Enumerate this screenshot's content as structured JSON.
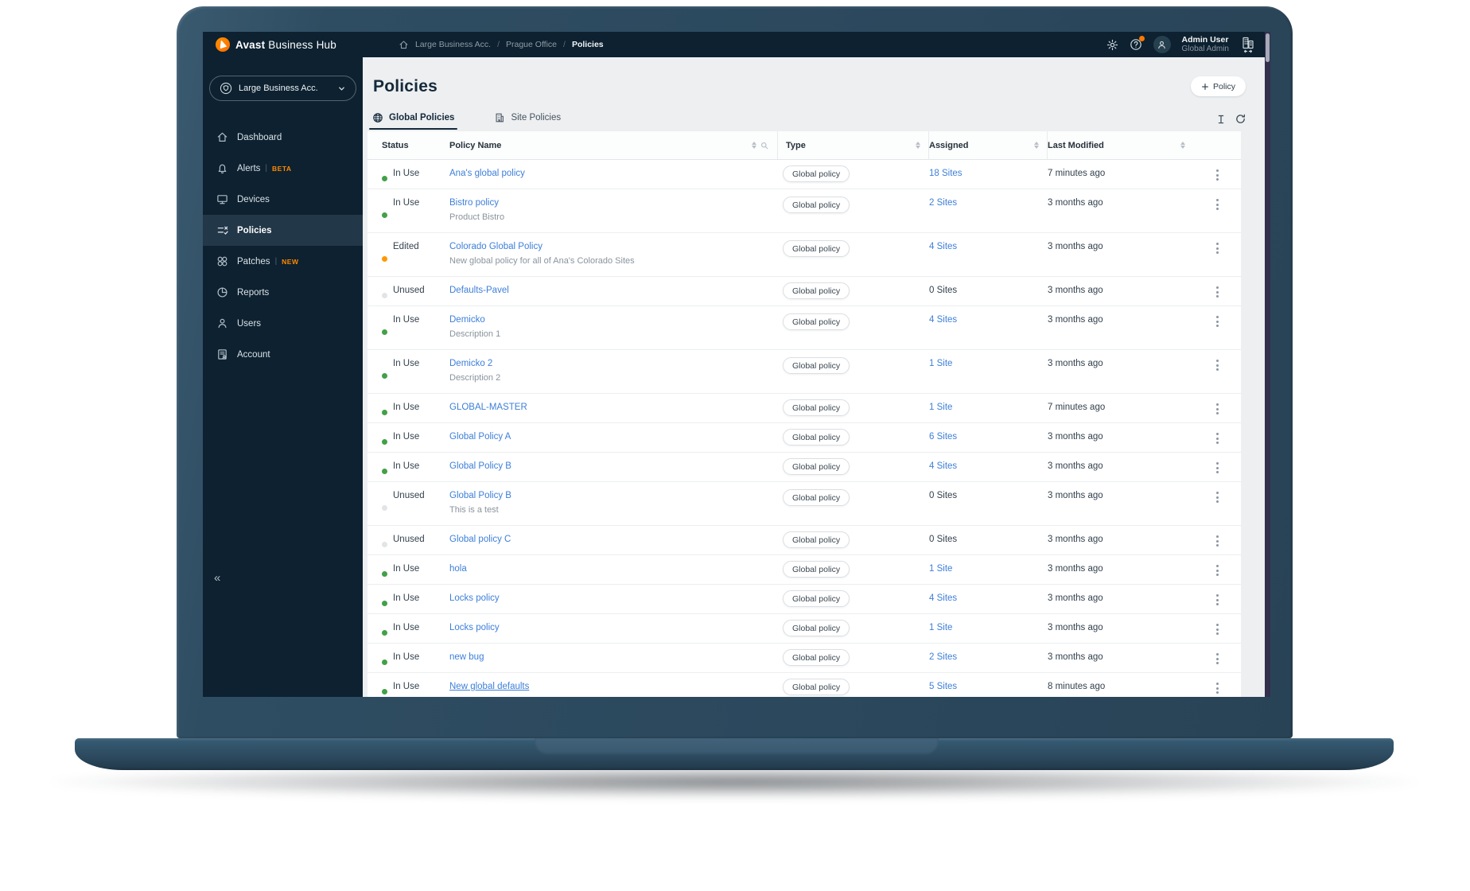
{
  "topbar": {
    "brand_bold": "Avast",
    "brand_rest": "Business Hub",
    "breadcrumb": {
      "items": [
        "Large Business Acc.",
        "Prague Office"
      ],
      "current": "Policies",
      "separator": "/"
    },
    "user": {
      "name": "Admin User",
      "role": "Global Admin"
    }
  },
  "sidebar": {
    "account_switcher": "Large Business Acc.",
    "items": [
      {
        "label": "Dashboard"
      },
      {
        "label": "Alerts",
        "badge": "BETA"
      },
      {
        "label": "Devices"
      },
      {
        "label": "Policies",
        "selected": true
      },
      {
        "label": "Patches",
        "badge": "NEW"
      },
      {
        "label": "Reports"
      },
      {
        "label": "Users"
      },
      {
        "label": "Account"
      }
    ]
  },
  "main": {
    "title": "Policies",
    "new_policy_button": "Policy",
    "tabs": [
      {
        "label": "Global Policies",
        "active": true
      },
      {
        "label": "Site Policies",
        "active": false
      }
    ],
    "table": {
      "columns": [
        "Status",
        "Policy Name",
        "Type",
        "Assigned",
        "Last Modified"
      ],
      "rows": [
        {
          "status": "In Use",
          "status_key": "in_use",
          "name": "Ana's global policy",
          "description": "",
          "type": "Global policy",
          "assigned": "18 Sites",
          "assigned_link": true,
          "modified": "7 minutes ago"
        },
        {
          "status": "In Use",
          "status_key": "in_use",
          "name": "Bistro policy",
          "description": "Product Bistro",
          "type": "Global policy",
          "assigned": "2 Sites",
          "assigned_link": true,
          "modified": "3 months ago"
        },
        {
          "status": "Edited",
          "status_key": "edited",
          "name": "Colorado Global Policy",
          "description": "New global policy for all of Ana's Colorado Sites",
          "type": "Global policy",
          "assigned": "4 Sites",
          "assigned_link": true,
          "modified": "3 months ago"
        },
        {
          "status": "Unused",
          "status_key": "unused",
          "name": "Defaults-Pavel",
          "description": "",
          "type": "Global policy",
          "assigned": "0 Sites",
          "assigned_link": false,
          "modified": "3 months ago"
        },
        {
          "status": "In Use",
          "status_key": "in_use",
          "name": "Demicko",
          "description": "Description 1",
          "type": "Global policy",
          "assigned": "4 Sites",
          "assigned_link": true,
          "modified": "3 months ago"
        },
        {
          "status": "In Use",
          "status_key": "in_use",
          "name": "Demicko 2",
          "description": "Description 2",
          "type": "Global policy",
          "assigned": "1 Site",
          "assigned_link": true,
          "modified": "3 months ago"
        },
        {
          "status": "In Use",
          "status_key": "in_use",
          "name": "GLOBAL-MASTER",
          "description": "",
          "type": "Global policy",
          "assigned": "1 Site",
          "assigned_link": true,
          "modified": "7 minutes ago"
        },
        {
          "status": "In Use",
          "status_key": "in_use",
          "name": "Global Policy A",
          "description": "",
          "type": "Global policy",
          "assigned": "6 Sites",
          "assigned_link": true,
          "modified": "3 months ago"
        },
        {
          "status": "In Use",
          "status_key": "in_use",
          "name": "Global Policy B",
          "description": "",
          "type": "Global policy",
          "assigned": "4 Sites",
          "assigned_link": true,
          "modified": "3 months ago"
        },
        {
          "status": "Unused",
          "status_key": "unused",
          "name": "Global Policy B",
          "description": "This is a test",
          "type": "Global policy",
          "assigned": "0 Sites",
          "assigned_link": false,
          "modified": "3 months ago"
        },
        {
          "status": "Unused",
          "status_key": "unused",
          "name": "Global policy C",
          "description": "",
          "type": "Global policy",
          "assigned": "0 Sites",
          "assigned_link": false,
          "modified": "3 months ago"
        },
        {
          "status": "In Use",
          "status_key": "in_use",
          "name": "hola",
          "description": "",
          "type": "Global policy",
          "assigned": "1 Site",
          "assigned_link": true,
          "modified": "3 months ago"
        },
        {
          "status": "In Use",
          "status_key": "in_use",
          "name": "Locks policy",
          "description": "",
          "type": "Global policy",
          "assigned": "4 Sites",
          "assigned_link": true,
          "modified": "3 months ago"
        },
        {
          "status": "In Use",
          "status_key": "in_use",
          "name": "Locks policy",
          "description": "",
          "type": "Global policy",
          "assigned": "1 Site",
          "assigned_link": true,
          "modified": "3 months ago"
        },
        {
          "status": "In Use",
          "status_key": "in_use",
          "name": "new bug",
          "description": "",
          "type": "Global policy",
          "assigned": "2 Sites",
          "assigned_link": true,
          "modified": "3 months ago"
        },
        {
          "status": "In Use",
          "status_key": "in_use",
          "name": "New global defaults",
          "description": "",
          "type": "Global policy",
          "assigned": "5 Sites",
          "assigned_link": true,
          "modified": "8 minutes ago",
          "hovered": true
        }
      ]
    }
  },
  "colors": {
    "accent_orange": "#ff7800",
    "link_blue": "#3d7fd9",
    "status": {
      "in_use": "#43a047",
      "edited": "#ff9800",
      "unused": "#e1e5e8"
    },
    "topbar_bg": "#0d2130",
    "main_bg": "#edeff1"
  }
}
